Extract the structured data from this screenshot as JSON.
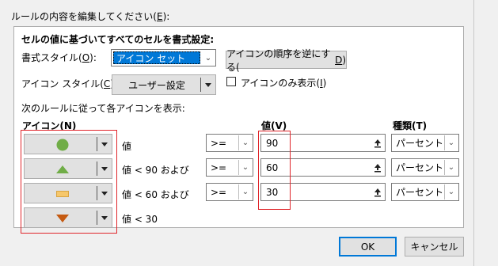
{
  "header": {
    "edit_rule_label": "ルールの内容を編集してください(",
    "edit_rule_key": "E",
    "edit_rule_suffix": "):"
  },
  "section": {
    "title": "セルの値に基づいてすべてのセルを書式設定:"
  },
  "format_style": {
    "label_prefix": "書式スタイル(",
    "key": "O",
    "label_suffix": "):",
    "value": "アイコン セット"
  },
  "reverse_button": {
    "prefix": "アイコンの順序を逆にする(",
    "key": "D",
    "suffix": ")"
  },
  "icon_style": {
    "label_prefix": "アイコン スタイル(",
    "key": "C",
    "label_suffix": "):",
    "value": "ユーザー設定"
  },
  "icon_only": {
    "prefix": "アイコンのみ表示(",
    "key": "I",
    "suffix": ")",
    "checked": false
  },
  "rules_caption": "次のルールに従って各アイコンを表示:",
  "columns": {
    "icon": "アイコン(N)",
    "value": "値(V)",
    "type": "種類(T)"
  },
  "rows": [
    {
      "icon": "circle-green",
      "desc": "値",
      "op": ">=",
      "value": "90",
      "type": "パーセント"
    },
    {
      "icon": "triangle-up-green",
      "desc": "値 < 90 および",
      "op": ">=",
      "value": "60",
      "type": "パーセント"
    },
    {
      "icon": "dash-yellow",
      "desc": "値 < 60 および",
      "op": ">=",
      "value": "30",
      "type": "パーセント"
    },
    {
      "icon": "triangle-down-orange",
      "desc": "値 < 30"
    }
  ],
  "buttons": {
    "ok": "OK",
    "cancel": "キャンセル"
  },
  "colors": {
    "highlight": "#e0262b",
    "circle": "#70ad47",
    "triangle_up": "#70ad47",
    "dash": "#f6c76b",
    "triangle_down": "#c55a11"
  }
}
